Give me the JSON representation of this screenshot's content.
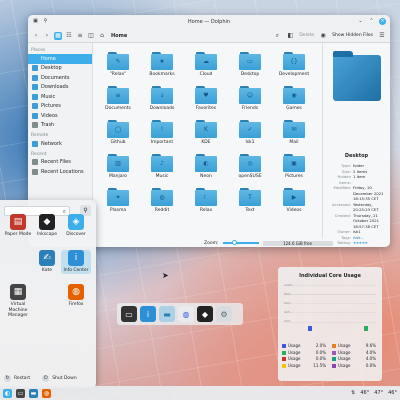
{
  "window": {
    "title": "Home — Dolphin",
    "breadcrumb": "Home",
    "delete_label": "Delete",
    "show_hidden_label": "Show Hidden Files"
  },
  "sidebar": {
    "places_header": "Places",
    "places": [
      {
        "label": "Home",
        "icon": "home-icon",
        "color": "#3daee9"
      },
      {
        "label": "Desktop",
        "icon": "desktop-icon",
        "color": "#3a9fd6"
      },
      {
        "label": "Documents",
        "icon": "documents-icon",
        "color": "#3a9fd6"
      },
      {
        "label": "Downloads",
        "icon": "downloads-icon",
        "color": "#3a9fd6"
      },
      {
        "label": "Music",
        "icon": "music-icon",
        "color": "#3a9fd6"
      },
      {
        "label": "Pictures",
        "icon": "pictures-icon",
        "color": "#3a9fd6"
      },
      {
        "label": "Videos",
        "icon": "videos-icon",
        "color": "#3a9fd6"
      },
      {
        "label": "Trash",
        "icon": "trash-icon",
        "color": "#7f8c8d"
      }
    ],
    "remote_header": "Remote",
    "remote": [
      {
        "label": "Network",
        "icon": "network-icon",
        "color": "#3a9fd6"
      }
    ],
    "recent_header": "Recent",
    "recent": [
      {
        "label": "Recent Files",
        "icon": "recent-files-icon",
        "color": "#7f8c8d"
      },
      {
        "label": "Recent Locations",
        "icon": "recent-locations-icon",
        "color": "#7f8c8d"
      }
    ]
  },
  "files": [
    {
      "name": "\"Relax\"",
      "glyph": "✎"
    },
    {
      "name": "Bookmarks",
      "glyph": "★"
    },
    {
      "name": "Cloud",
      "glyph": "☁"
    },
    {
      "name": "Desktop",
      "glyph": "▭"
    },
    {
      "name": "Development",
      "glyph": "{}"
    },
    {
      "name": "Documents",
      "glyph": "≡"
    },
    {
      "name": "Downloads",
      "glyph": "↓"
    },
    {
      "name": "Favorites",
      "glyph": "♥"
    },
    {
      "name": "Friends",
      "glyph": "☺"
    },
    {
      "name": "Games",
      "glyph": "◉"
    },
    {
      "name": "Github",
      "glyph": "◯"
    },
    {
      "name": "Important",
      "glyph": "!"
    },
    {
      "name": "KDE",
      "glyph": "K"
    },
    {
      "name": "lsk1",
      "glyph": "✓"
    },
    {
      "name": "Mail",
      "glyph": "✉"
    },
    {
      "name": "Manjaro",
      "glyph": "▥"
    },
    {
      "name": "Music",
      "glyph": "♪"
    },
    {
      "name": "Neon",
      "glyph": "◐"
    },
    {
      "name": "openSUSE",
      "glyph": "◎"
    },
    {
      "name": "Pictures",
      "glyph": "▣"
    },
    {
      "name": "Plasma",
      "glyph": "✦"
    },
    {
      "name": "Reddit",
      "glyph": "◍"
    },
    {
      "name": "Relax",
      "glyph": "☾"
    },
    {
      "name": "Text",
      "glyph": "T"
    },
    {
      "name": "Videos",
      "glyph": "▶"
    }
  ],
  "statusbar": {
    "zoom_label": "Zoom:",
    "zoom_level": 0.33,
    "free_space": "124.6 GiB free"
  },
  "info_panel": {
    "title": "Desktop",
    "rows": [
      {
        "k": "Type:",
        "v": "folder"
      },
      {
        "k": "Size:",
        "v": "2 items"
      },
      {
        "k": "Hidden items:",
        "v": "1 item"
      },
      {
        "k": "Modified:",
        "v": "Friday, 10 December 2021 16:15:35 CET"
      },
      {
        "k": "Accessed:",
        "v": "Yesterday, 20:25:23 CET"
      },
      {
        "k": "Created:",
        "v": "Thursday, 21 October 2021 18:57:38 CET"
      },
      {
        "k": "Owner:",
        "v": "lsk1"
      },
      {
        "k": "Tags:",
        "v": "Add..."
      },
      {
        "k": "Rating:",
        "v": "★★★★★"
      },
      {
        "k": "Comment:",
        "v": "Add..."
      }
    ]
  },
  "launcher": {
    "apps": [
      {
        "label": "Paper Mode",
        "icon": "paper-icon",
        "color": "#c0392b",
        "glyph": "▤"
      },
      {
        "label": "Inkscape",
        "icon": "inkscape-icon",
        "color": "#222222",
        "glyph": "◆"
      },
      {
        "label": "Discover",
        "icon": "discover-icon",
        "color": "#3daee9",
        "glyph": "◈"
      },
      {
        "label": "Kate",
        "icon": "kate-icon",
        "color": "#2c7fb8",
        "glyph": "✍"
      },
      {
        "label": "Info Center",
        "icon": "info-center-icon",
        "color": "#2d8fd5",
        "glyph": "i"
      },
      {
        "label": "Virtual Machine Manager",
        "icon": "vm-manager-icon",
        "color": "#444444",
        "glyph": "▦"
      },
      {
        "label": "Firefox",
        "icon": "firefox-icon",
        "color": "#e66000",
        "glyph": "◍"
      }
    ],
    "restart_label": "Restart",
    "shutdown_label": "Shut Down"
  },
  "widget": {
    "title": "Individual Core Usage",
    "cores": [
      {
        "label": "Usage",
        "value": "2.0%",
        "color": "#3d5bd9"
      },
      {
        "label": "Usage",
        "value": "9.6%",
        "color": "#e67e22"
      },
      {
        "label": "Usage",
        "value": "0.0%",
        "color": "#27ae60"
      },
      {
        "label": "Usage",
        "value": "4.0%",
        "color": "#9b59b6"
      },
      {
        "label": "Usage",
        "value": "0.0%",
        "color": "#c0392b"
      },
      {
        "label": "Usage",
        "value": "4.0%",
        "color": "#16a085"
      },
      {
        "label": "Usage",
        "value": "11.5%",
        "color": "#f1c40f"
      },
      {
        "label": "Usage",
        "value": "0.0%",
        "color": "#8e44ad"
      }
    ]
  },
  "taskbar": {
    "temps": [
      "46°",
      "47°",
      "46°"
    ]
  },
  "colors": {
    "accent": "#3daee9",
    "folder": "#3a9fd6"
  }
}
